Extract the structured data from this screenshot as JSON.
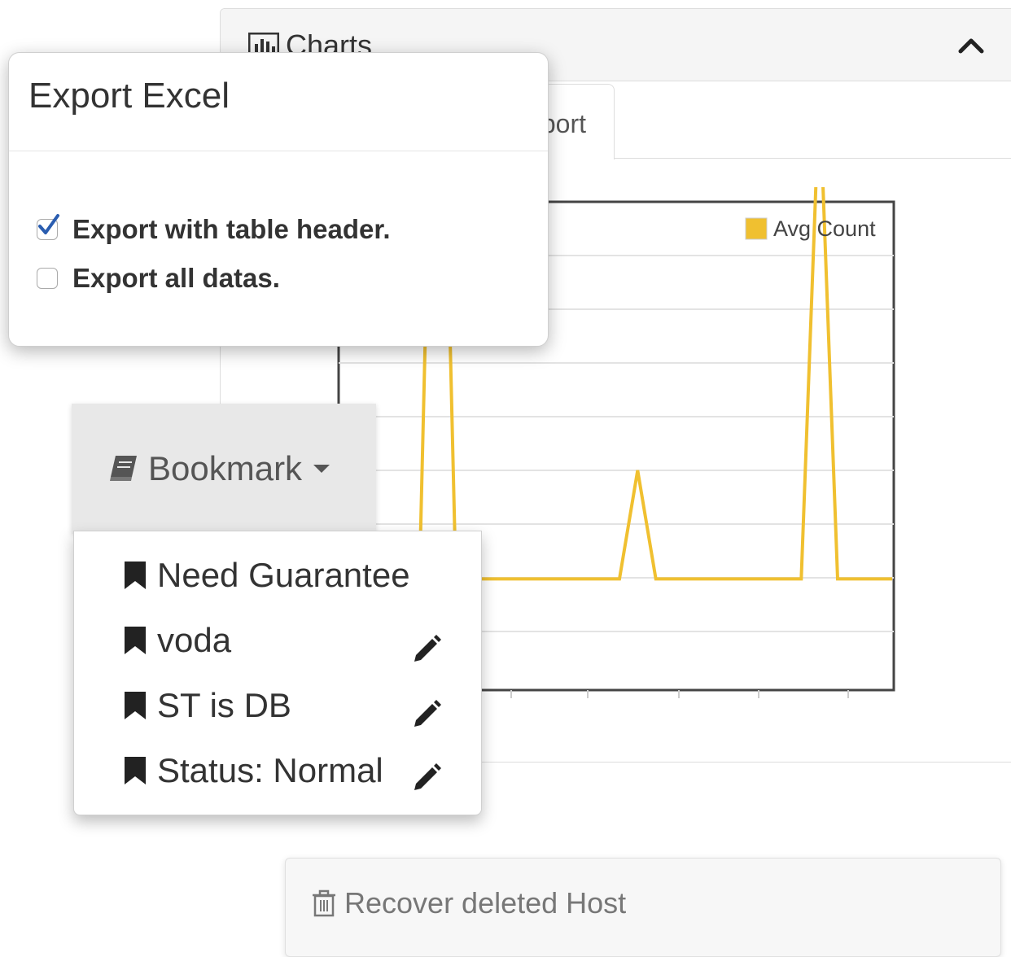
{
  "panel": {
    "title": "Charts",
    "tab_label_partial": "port"
  },
  "chart_data": {
    "type": "line",
    "series": [
      {
        "name": "Avg Count",
        "color": "#f0c030",
        "points": [
          [
            0,
            1
          ],
          [
            0.8,
            1
          ],
          [
            1,
            15
          ],
          [
            1.2,
            1
          ],
          [
            3,
            1
          ],
          [
            3.2,
            3
          ],
          [
            3.4,
            1
          ],
          [
            5,
            1
          ],
          [
            5.2,
            10
          ],
          [
            5.4,
            1
          ],
          [
            6,
            1
          ]
        ]
      }
    ],
    "yticks": [
      10
    ],
    "legend_position": "top-right",
    "grid": true
  },
  "modal": {
    "title": "Export Excel",
    "options": [
      {
        "label": "Export with table header.",
        "checked": true
      },
      {
        "label": "Export all datas.",
        "checked": false
      }
    ]
  },
  "bookmark": {
    "button_label": "Bookmark",
    "items": [
      {
        "label": "Need Guarantee",
        "editable": false
      },
      {
        "label": "voda",
        "editable": true
      },
      {
        "label": "ST is DB",
        "editable": true
      },
      {
        "label": "Status: Normal",
        "editable": true
      }
    ]
  },
  "recover": {
    "label": "Recover deleted Host"
  }
}
